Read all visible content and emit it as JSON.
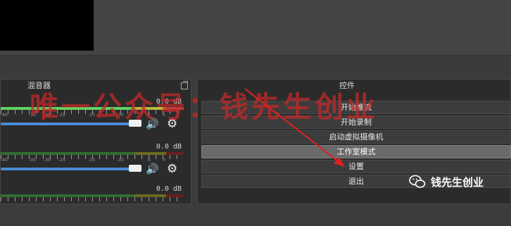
{
  "mixer": {
    "title": "混音器",
    "channels": [
      {
        "db_label": "0.0 dB",
        "level": 1.0
      },
      {
        "db_label": "0.0 dB",
        "level": 0.0
      },
      {
        "db_label": "0.0 dB",
        "level": 0.0
      }
    ],
    "tick_labels": [
      "-60",
      "-55",
      "-50",
      "-45",
      "-40",
      "-35",
      "-30",
      "-25",
      "-20",
      "-15",
      "-10",
      "-5",
      "0"
    ]
  },
  "controls": {
    "title": "控件",
    "buttons": [
      {
        "label": "开始推流"
      },
      {
        "label": "开始录制"
      },
      {
        "label": "启动虚拟摄像机"
      },
      {
        "label": "工作室模式",
        "active": true
      },
      {
        "label": "设置"
      },
      {
        "label": "退出"
      }
    ]
  },
  "watermark": {
    "text": "唯一公众号：钱先生创业"
  },
  "brand": {
    "text": "钱先生创业"
  },
  "colors": {
    "accent_blue": "#4a8bd8",
    "meter_green": "#5fd35f",
    "watermark_red": "#c82828",
    "arrow_red": "#e02020"
  },
  "icons": {
    "volume": "speaker-icon",
    "settings": "gear-icon",
    "float": "float-dock-icon",
    "brand": "wechat-icon"
  }
}
